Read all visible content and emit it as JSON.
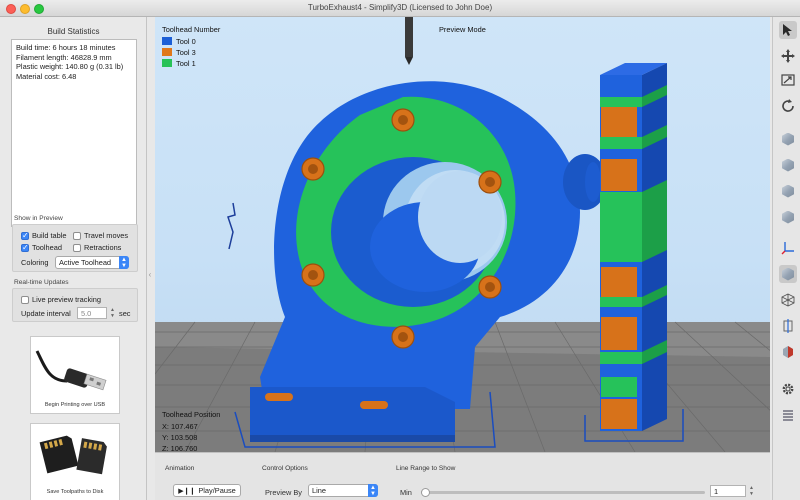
{
  "window": {
    "title": "TurboExhaust4 - Simplify3D (Licensed to John Doe)"
  },
  "left_panel": {
    "title": "Build Statistics",
    "stats": [
      "Build time: 6 hours 18 minutes",
      "Filament length: 46828.9 mm",
      "Plastic weight: 140.80 g (0.31 lb)",
      "Material cost: 6.48"
    ],
    "show_in_preview": {
      "label": "Show in Preview",
      "build_table": "Build table",
      "travel_moves": "Travel moves",
      "toolhead": "Toolhead",
      "retractions": "Retractions",
      "coloring_label": "Coloring",
      "coloring_value": "Active Toolhead"
    },
    "realtime": {
      "label": "Real-time Updates",
      "live_preview": "Live preview tracking",
      "interval_label": "Update interval",
      "interval_value": "5.0",
      "interval_unit": "sec"
    },
    "usb_caption": "Begin Printing over USB",
    "sd_caption": "Save Toolpaths to Disk"
  },
  "viewport": {
    "legend_title": "Toolhead Number",
    "legend": [
      {
        "label": "Tool 0",
        "color": "#1c5fd6"
      },
      {
        "label": "Tool 3",
        "color": "#e0781a"
      },
      {
        "label": "Tool 1",
        "color": "#27c258"
      }
    ],
    "mode_label": "Preview Mode",
    "position_title": "Toolhead Position",
    "position": {
      "x": "X: 107.467",
      "y": "Y: 103.508",
      "z": "Z: 106.760"
    }
  },
  "bottom": {
    "animation_label": "Animation",
    "play_label": "Play/Pause",
    "control_label": "Control Options",
    "preview_by_label": "Preview By",
    "preview_by_value": "Line",
    "range_label": "Line Range to Show",
    "min_label": "Min",
    "min_value": "1"
  },
  "colors": {
    "tool0": "#1c5fd6",
    "tool3": "#e0781a",
    "tool1": "#27c258",
    "accent": "#3b86f7"
  }
}
